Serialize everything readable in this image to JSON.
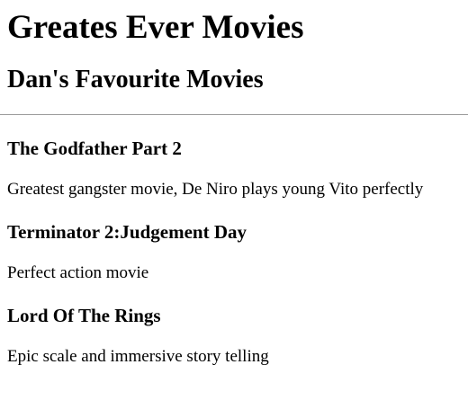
{
  "page": {
    "title": "Greates Ever Movies",
    "subtitle": "Dan's Favourite Movies"
  },
  "movies": [
    {
      "title": "The Godfather Part 2",
      "description": "Greatest gangster movie, De Niro plays young Vito perfectly"
    },
    {
      "title": "Terminator 2:Judgement Day",
      "description": "Perfect action movie"
    },
    {
      "title": "Lord Of The Rings",
      "description": "Epic scale and immersive story telling"
    }
  ]
}
